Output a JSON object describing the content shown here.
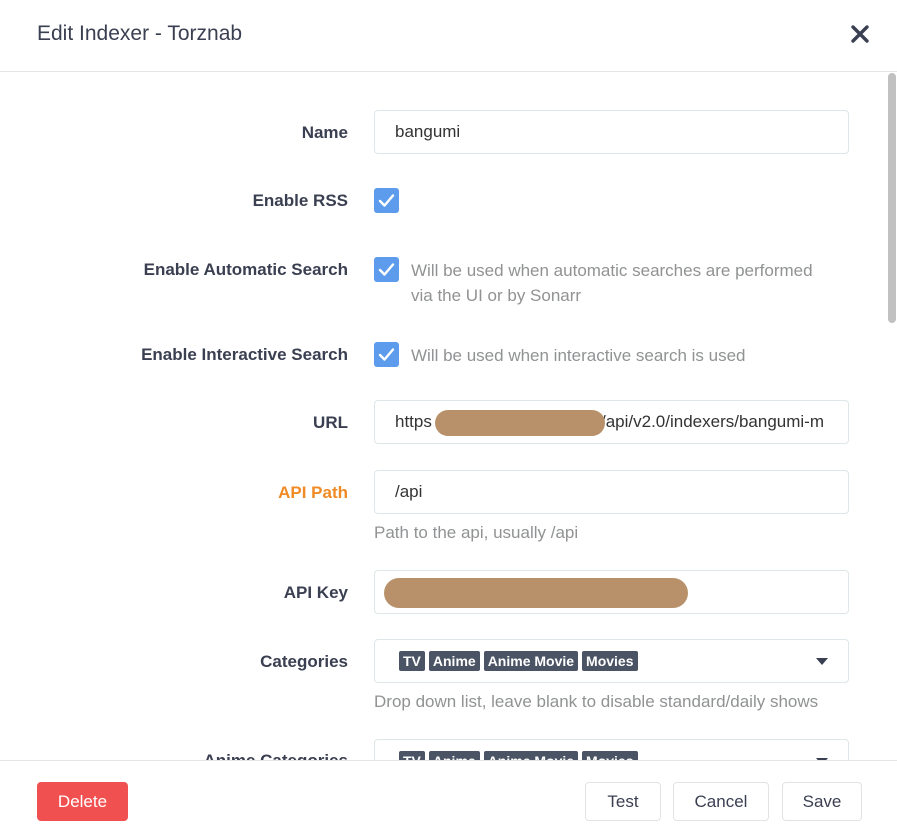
{
  "dialog": {
    "title": "Edit Indexer - Torznab",
    "close_icon": "close-icon"
  },
  "fields": {
    "name": {
      "label": "Name",
      "value": "bangumi"
    },
    "enable_rss": {
      "label": "Enable RSS",
      "checked": true
    },
    "enable_auto_search": {
      "label": "Enable Automatic Search",
      "checked": true,
      "help_line1": "Will be used when automatic searches are performed",
      "help_line2": "via the UI or by Sonarr"
    },
    "enable_interactive_search": {
      "label": "Enable Interactive Search",
      "checked": true,
      "help": "Will be used when interactive search is used"
    },
    "url": {
      "label": "URL",
      "value_start": "https",
      "value_end": "/api/v2.0/indexers/bangumi-m"
    },
    "api_path": {
      "label": "API Path",
      "value": "/api",
      "help": "Path to the api, usually /api"
    },
    "api_key": {
      "label": "API Key"
    },
    "categories": {
      "label": "Categories",
      "tags": [
        "TV",
        "Anime",
        "Anime Movie",
        "Movies"
      ],
      "help": "Drop down list, leave blank to disable standard/daily shows"
    },
    "anime_categories": {
      "label": "Anime Categories",
      "tags": [
        "TV",
        "Anime",
        "Anime Movie",
        "Movies"
      ]
    }
  },
  "footer": {
    "delete_label": "Delete",
    "test_label": "Test",
    "cancel_label": "Cancel",
    "save_label": "Save"
  },
  "colors": {
    "accent": "#5d9cec",
    "danger": "#f05050",
    "warning": "#f08a24",
    "tag": "#4b5465"
  }
}
